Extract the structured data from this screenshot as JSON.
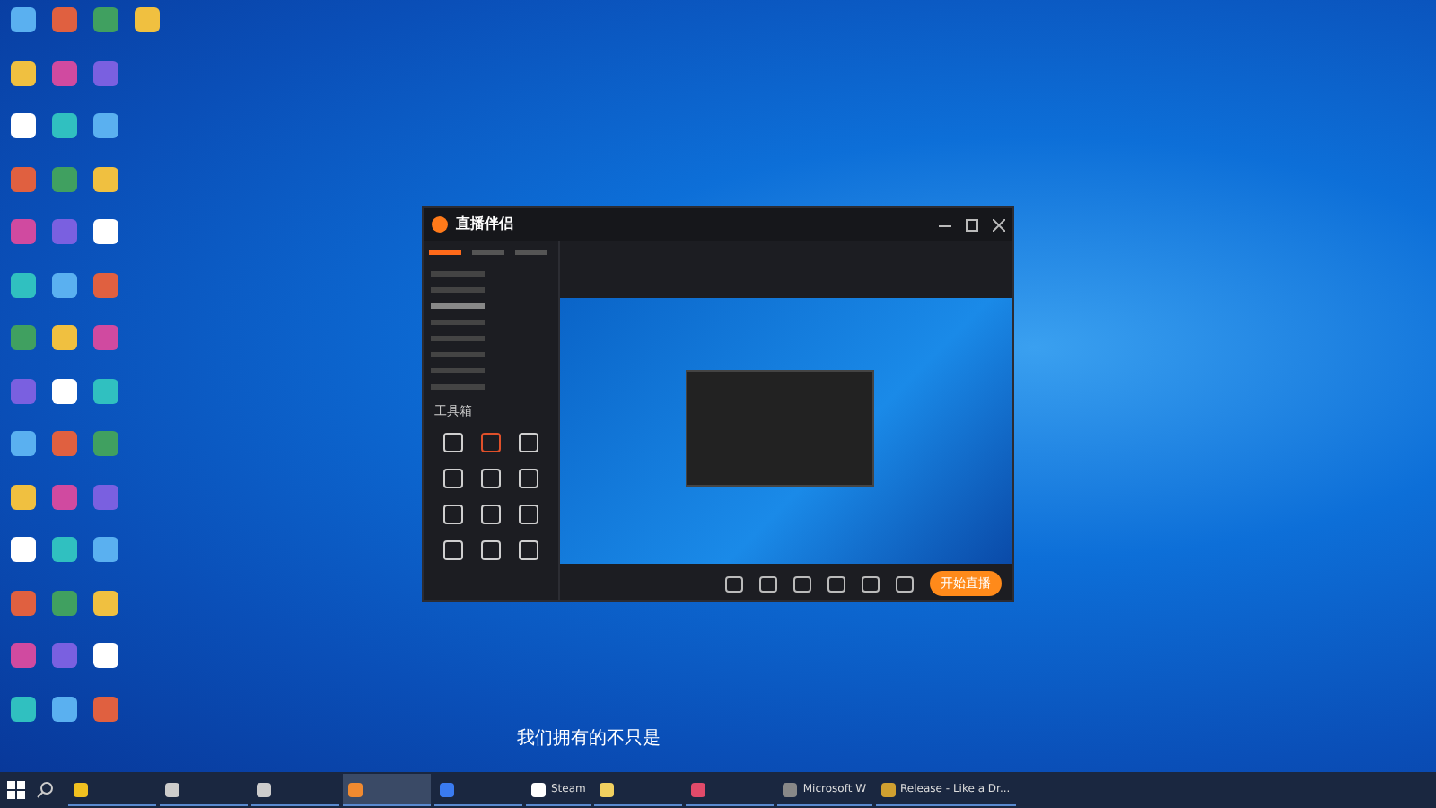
{
  "app_window": {
    "logo": "直播伴侣",
    "left_tabs": [
      {
        "selected": true
      },
      {
        "selected": false
      },
      {
        "selected": false
      }
    ],
    "scenes": [
      {
        "selected": false
      },
      {
        "selected": false
      },
      {
        "selected": true
      },
      {
        "selected": false
      },
      {
        "selected": false
      },
      {
        "selected": false
      },
      {
        "selected": false
      },
      {
        "selected": false
      }
    ],
    "toolbox_title": "工具箱",
    "tools": [
      {
        "color": "#cfcfcf"
      },
      {
        "color": "#e0502a"
      },
      {
        "color": "#cfcfcf"
      },
      {
        "color": "#cfcfcf"
      },
      {
        "color": "#cfcfcf"
      },
      {
        "color": "#cfcfcf"
      },
      {
        "color": "#cfcfcf"
      },
      {
        "color": "#cfcfcf"
      },
      {
        "color": "#cfcfcf"
      },
      {
        "color": "#cfcfcf"
      },
      {
        "color": "#cfcfcf"
      },
      {
        "color": "#cfcfcf"
      }
    ],
    "start_button": "开始直播"
  },
  "subtitle": "我们拥有的不只是",
  "taskbar": {
    "items": [
      {
        "color": "#f0c020",
        "active": false
      },
      {
        "color": "#cccccc",
        "active": false
      },
      {
        "color": "#cccccc",
        "active": false
      },
      {
        "color": "#f08a30",
        "active": true
      },
      {
        "color": "#3a7bf0",
        "active": false
      },
      {
        "label": "Steam",
        "color": "#ffffff",
        "active": false
      },
      {
        "color": "#f0d060",
        "active": false
      },
      {
        "color": "#e04a6a",
        "active": false
      },
      {
        "label": "Microsoft W",
        "color": "#888888",
        "active": false
      },
      {
        "label": "Release - Like a Dr...",
        "color": "#d0a030",
        "active": false
      }
    ]
  }
}
